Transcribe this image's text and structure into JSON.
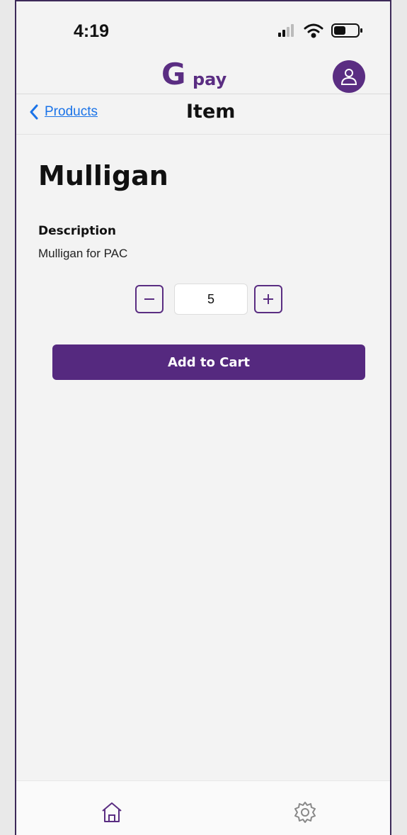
{
  "status_bar": {
    "time": "4:19",
    "icons": [
      "signal-icon",
      "wifi-icon",
      "battery-icon"
    ]
  },
  "header": {
    "logo_mark": "G",
    "logo_text": "pay",
    "avatar_icon": "user-icon"
  },
  "nav": {
    "back_label": "Products",
    "title": "Item"
  },
  "product": {
    "name": "Mulligan",
    "description_heading": "Description",
    "description": "Mulligan for PAC",
    "quantity": "5"
  },
  "actions": {
    "add_to_cart": "Add to Cart"
  },
  "tab_bar": {
    "tabs": [
      "home-icon",
      "settings-icon"
    ]
  },
  "colors": {
    "brand": "#55297f",
    "link": "#1a73e8",
    "background": "#f3f3f3"
  }
}
